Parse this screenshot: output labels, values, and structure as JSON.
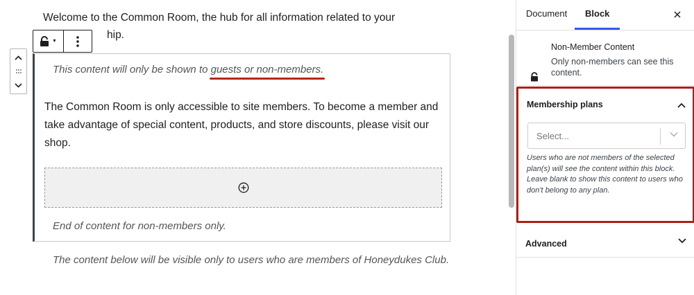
{
  "editor": {
    "intro_line1": "Welcome to the Common Room, the hub for all information related to your",
    "intro_line2": "hip.",
    "block": {
      "intro_before": "This content will only be shown to ",
      "intro_highlight": "guests or non-members.",
      "body": "The Common Room is only accessible to site members. To become a member and take advantage of special content, products, and store discounts, please visit our shop.",
      "end_text": "End of content for non-members only."
    },
    "below_text": "The content below will be visible only to users who are members of Honeydukes Club."
  },
  "sidebar": {
    "tabs": [
      {
        "label": "Document",
        "active": false
      },
      {
        "label": "Block",
        "active": true
      }
    ],
    "block_card": {
      "title": "Non-Member Content",
      "description": "Only non-members can see this content."
    },
    "membership_plans": {
      "heading": "Membership plans",
      "select_placeholder": "Select...",
      "help_text": "Users who are not members of the selected plan(s) will see the content within this block. Leave blank to show this content to users who don't belong to any plan."
    },
    "advanced": {
      "heading": "Advanced"
    }
  },
  "colors": {
    "accent": "#3858e9",
    "highlight_border": "#ad1f16",
    "underline": "#b6261b"
  },
  "icons": {
    "toolbar_block": "lock-icon",
    "toolbar_options": "vertical-dots-icon",
    "card": "lock-icon",
    "close": "close-icon"
  }
}
